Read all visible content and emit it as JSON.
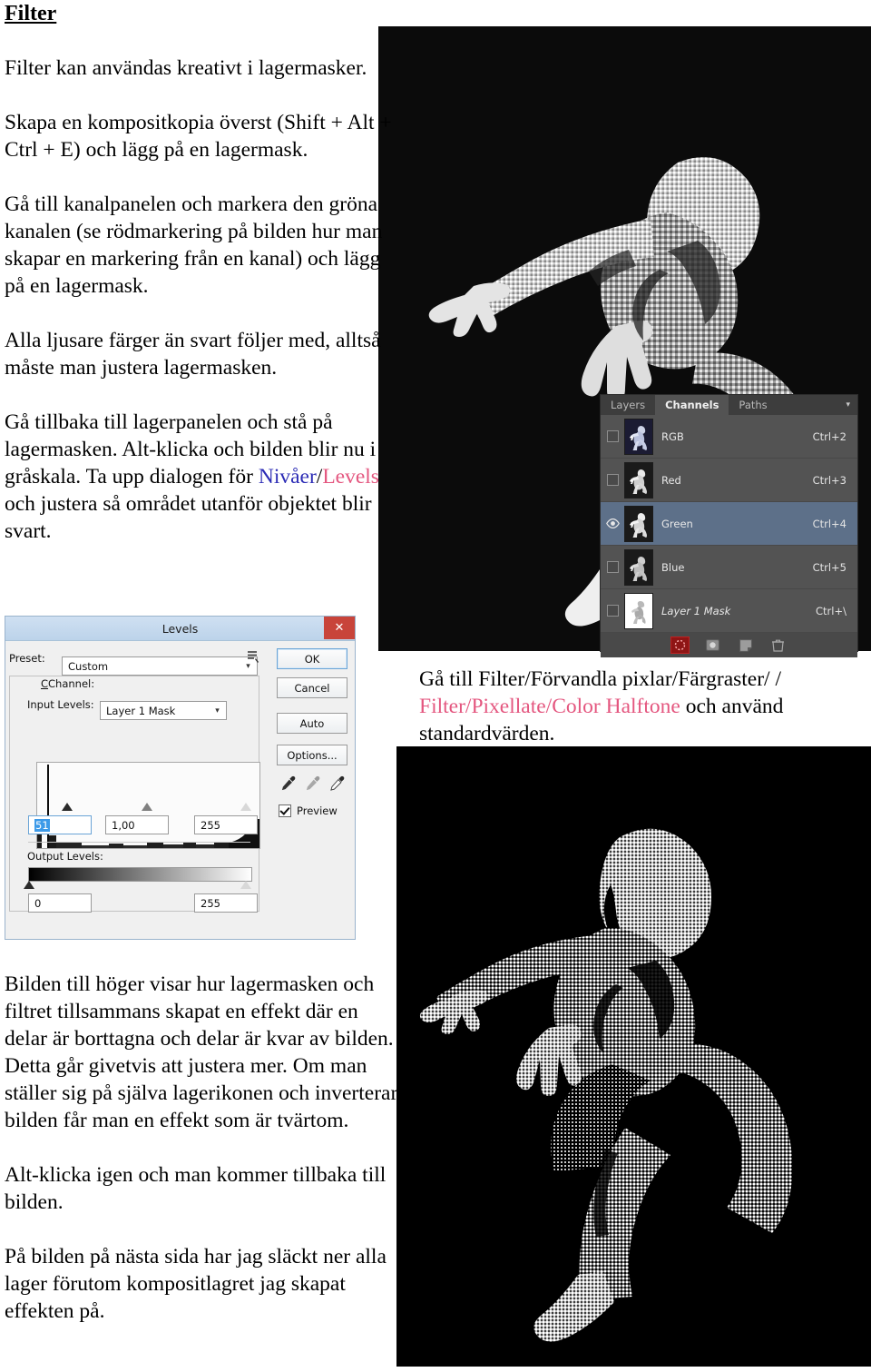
{
  "document": {
    "heading": "Filter",
    "paragraphs": [
      "Filter kan användas kreativt i lagermasker.",
      "Skapa en kompositkopia överst (Shift + Alt + Ctrl + E) och lägg på  en lagermask.",
      "Gå till kanalpanelen och markera den gröna kanalen (se rödmarkering på bilden hur man skapar en markering från en kanal) och lägg på en lagermask.",
      "Alla ljusare färger än svart följer med, alltså måste man justera lagermasken."
    ],
    "levels_paragraph": {
      "before": "Gå tillbaka till lagerpanelen och stå på lagermasken. Alt-klicka och bilden blir nu i gråskala. Ta upp dialogen för ",
      "term_sv": "Nivåer",
      "separator": "/",
      "term_en": "Levels",
      "after": " och justera så området utanför objektet blir svart."
    },
    "halftone_paragraph": {
      "before": "Gå till Filter/Förvandla pixlar/Färgraster/ /",
      "term_en": "Filter/Pixellate/Color Halftone",
      "after": " och använd standardvärden."
    },
    "bottom_paragraphs": [
      "Bilden till höger visar hur lagermasken och filtret tillsammans skapat en effekt där en delar är borttagna och delar är kvar av bilden. Detta går givetvis att justera mer. Om man ställer sig på själva lagerikonen och inverterar bilden får man en effekt som är tvärtom.",
      "Alt-klicka igen och man kommer tillbaka till bilden.",
      "På bilden på nästa sida har jag släckt ner alla lager förutom kompositlagret jag skapat effekten på."
    ],
    "colors": {
      "swedish_term": "#2b2bb5",
      "english_term": "#e4567f",
      "highlight_red": "#8e1515"
    }
  },
  "channels_panel": {
    "tabs": [
      {
        "label": "Layers",
        "active": false
      },
      {
        "label": "Channels",
        "active": true
      },
      {
        "label": "Paths",
        "active": false
      }
    ],
    "menu_icon": "chevron-down-icon",
    "rows": [
      {
        "name": "RGB",
        "shortcut": "Ctrl+2",
        "visible": false,
        "selected": false,
        "italic": false,
        "thumb": "rgb"
      },
      {
        "name": "Red",
        "shortcut": "Ctrl+3",
        "visible": false,
        "selected": false,
        "italic": false,
        "thumb": "gray"
      },
      {
        "name": "Green",
        "shortcut": "Ctrl+4",
        "visible": true,
        "selected": true,
        "italic": false,
        "thumb": "gray"
      },
      {
        "name": "Blue",
        "shortcut": "Ctrl+5",
        "visible": false,
        "selected": false,
        "italic": false,
        "thumb": "gray"
      },
      {
        "name": "Layer 1 Mask",
        "shortcut": "Ctrl+\\",
        "visible": false,
        "selected": false,
        "italic": true,
        "thumb": "mask"
      }
    ],
    "footer_buttons": [
      {
        "icon": "load-channel-as-selection-icon",
        "highlighted": true
      },
      {
        "icon": "save-selection-as-channel-icon",
        "highlighted": false
      },
      {
        "icon": "new-channel-icon",
        "highlighted": false
      },
      {
        "icon": "delete-channel-icon",
        "highlighted": false
      }
    ]
  },
  "levels_dialog": {
    "title": "Levels",
    "close_glyph": "✕",
    "preset_label": "Preset:",
    "preset_value": "Custom",
    "preset_menu_icon": "preset-options-icon",
    "channel_label": "Channel:",
    "channel_value": "Layer 1 Mask",
    "input_levels_label": "Input Levels:",
    "input_shadow": "51",
    "input_midtone": "1,00",
    "input_highlight": "255",
    "output_levels_label": "Output Levels:",
    "output_black": "0",
    "output_white": "255",
    "buttons": {
      "ok": "OK",
      "cancel": "Cancel",
      "auto": "Auto",
      "options": "Options..."
    },
    "eyedroppers": [
      "black-point-eyedropper-icon",
      "gray-point-eyedropper-icon",
      "white-point-eyedropper-icon"
    ],
    "preview_label": "Preview",
    "preview_checked": true
  },
  "images": {
    "top": {
      "alt": "dancer-pixellated-grayscale",
      "background": "#0b0b0b"
    },
    "bottom": {
      "alt": "dancer-color-halftone-black-white",
      "background": "#000000"
    }
  }
}
